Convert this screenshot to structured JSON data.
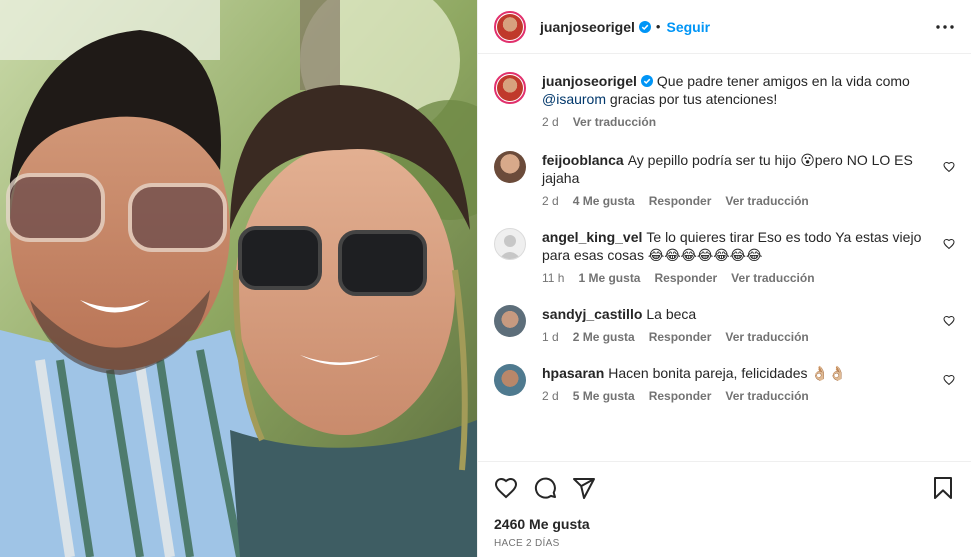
{
  "post": {
    "username": "juanjoseorigel",
    "follow_label": "Seguir",
    "separator": "•",
    "verified": true
  },
  "caption": {
    "username": "juanjoseorigel",
    "text_before": "Que padre tener amigos en la vida como",
    "mention": "@isaurom",
    "text_after": "gracias por tus atenciones!",
    "age": "2 d",
    "translate": "Ver traducción"
  },
  "comments": [
    {
      "username": "feijooblanca",
      "text": "Ay pepillo podría ser tu hijo 😮pero NO LO ES jajaha",
      "age": "2 d",
      "likes": "4 Me gusta",
      "reply": "Responder",
      "translate": "Ver traducción"
    },
    {
      "username": "angel_king_vel",
      "text": "Te lo quieres tirar Eso es todo Ya estas viejo para esas cosas 😂😂😂😂😂😂😂",
      "age": "11 h",
      "likes": "1 Me gusta",
      "reply": "Responder",
      "translate": "Ver traducción"
    },
    {
      "username": "sandyj_castillo",
      "text": "La beca",
      "age": "1 d",
      "likes": "2 Me gusta",
      "reply": "Responder",
      "translate": "Ver traducción"
    },
    {
      "username": "hpasaran",
      "text": "Hacen bonita pareja, felicidades 👌🏼👌🏼",
      "age": "2 d",
      "likes": "5 Me gusta",
      "reply": "Responder",
      "translate": "Ver traducción"
    }
  ],
  "footer": {
    "likes": "2460 Me gusta",
    "posted": "HACE 2 DÍAS"
  },
  "colors": {
    "accent": "#0095f6",
    "mention": "#00376b",
    "muted": "#737373",
    "text": "#262626"
  },
  "icons": [
    "verified-badge-icon",
    "more-options-icon",
    "heart-icon",
    "comment-icon",
    "share-icon",
    "bookmark-icon"
  ]
}
